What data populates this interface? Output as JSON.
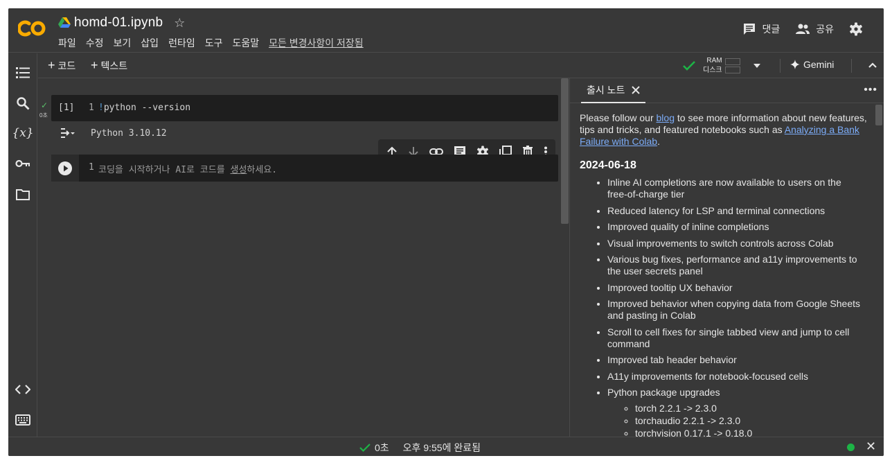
{
  "app": {
    "filename": "homd-01.ipynb"
  },
  "menu": [
    "파일",
    "수정",
    "보기",
    "삽입",
    "런타임",
    "도구",
    "도움말"
  ],
  "save_status": "모든 변경사항이 저장됨",
  "header": {
    "comments_label": "댓글",
    "share_label": "공유"
  },
  "toolbar": {
    "add_code": "코드",
    "add_text": "텍스트",
    "ram_label": "RAM",
    "disk_label": "디스크",
    "gemini_label": "Gemini"
  },
  "cells": {
    "cell1": {
      "exec_count": "[1]",
      "line_number": "1",
      "code_bang": "!",
      "code_rest": "python --version",
      "exec_time": "0초",
      "output": "Python 3.10.12"
    },
    "cell2": {
      "line_number": "1",
      "placeholder_a": "코딩을 시작하거나 AI로 코드를 ",
      "placeholder_link": "생성",
      "placeholder_b": "하세요."
    }
  },
  "panel": {
    "tab_label": "출시 노트",
    "intro_a": "Please follow our ",
    "intro_link1": "blog",
    "intro_b": " to see more information about new features, tips and tricks, and featured notebooks such as ",
    "intro_link2": "Analyzing a Bank Failure with Colab",
    "intro_c": ".",
    "date": "2024-06-18",
    "items": [
      "Inline AI completions are now available to users on the free-of-charge tier",
      "Reduced latency for LSP and terminal connections",
      "Improved quality of inline completions",
      "Visual improvements to switch controls across Colab",
      "Various bug fixes, performance and a11y improvements to the user secrets panel",
      "Improved tooltip UX behavior",
      "Improved behavior when copying data from Google Sheets and pasting in Colab",
      "Scroll to cell fixes for single tabbed view and jump to cell command",
      "Improved tab header behavior",
      "A11y improvements for notebook-focused cells",
      "Python package upgrades"
    ],
    "sub_items": [
      "torch 2.2.1 -> 2.3.0",
      "torchaudio 2.2.1 -> 2.3.0",
      "torchvision 0.17.1 -> 0.18.0"
    ]
  },
  "status": {
    "time": "0초",
    "completed": "오후 9:55에 완료됨"
  },
  "colors": {
    "accent_orange": "#F9AB00",
    "status_green": "#1DB446",
    "link_blue": "#7CACF8"
  }
}
